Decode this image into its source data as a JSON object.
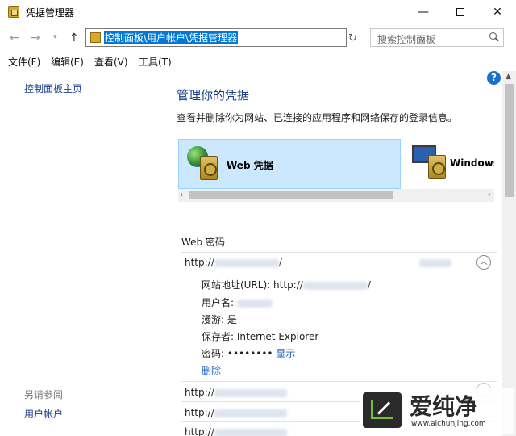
{
  "window": {
    "title": "凭据管理器",
    "min_glyph": "—",
    "close_glyph": "✕"
  },
  "nav": {
    "back_glyph": "←",
    "forward_glyph": "→",
    "recent_glyph": "▾",
    "up_glyph": "↑",
    "address": "控制面板\\用户帐户\\凭据管理器",
    "address_drop_glyph": "∨",
    "refresh_glyph": "↻",
    "search_placeholder": "搜索控制面板"
  },
  "menu": [
    "文件(F)",
    "编辑(E)",
    "查看(V)",
    "工具(T)"
  ],
  "left_pane": {
    "home_link": "控制面板主页",
    "see_also": "另请参阅",
    "user_accounts": "用户帐户"
  },
  "main": {
    "help_glyph": "?",
    "title": "管理你的凭据",
    "description": "查看并删除你为网站、已连接的应用程序和网络保存的登录信息。",
    "cards": [
      {
        "label": "Web 凭据",
        "selected": true
      },
      {
        "label": "Windows",
        "selected": false
      }
    ],
    "hscroll_left": "‹",
    "hscroll_right": "›",
    "section_title": "Web 密码",
    "credentials": [
      {
        "url_prefix": "http://",
        "url_suffix": "/",
        "expanded": true
      },
      {
        "url_prefix": "http://",
        "url_suffix": "",
        "expanded": false
      },
      {
        "url_prefix": "http://",
        "url_suffix": "",
        "expanded": false
      },
      {
        "url_prefix": "http://",
        "url_suffix": "",
        "expanded": false
      }
    ],
    "collapse_glyph": "︿",
    "details": {
      "site_label": "网站地址(URL):",
      "site_prefix": "http://",
      "site_suffix": "/",
      "username_label": "用户名:",
      "roaming": "漫游: 是",
      "saved_by": "保存者:  Internet Explorer",
      "password_label": "密码:",
      "password_mask": "••••••••",
      "show_link": "显示",
      "delete_link": "删除"
    }
  },
  "vscroll_up": "▲",
  "watermark": {
    "text": "爱纯净",
    "url": "www.aichunjing.com",
    "accent": "#6fc23a"
  }
}
